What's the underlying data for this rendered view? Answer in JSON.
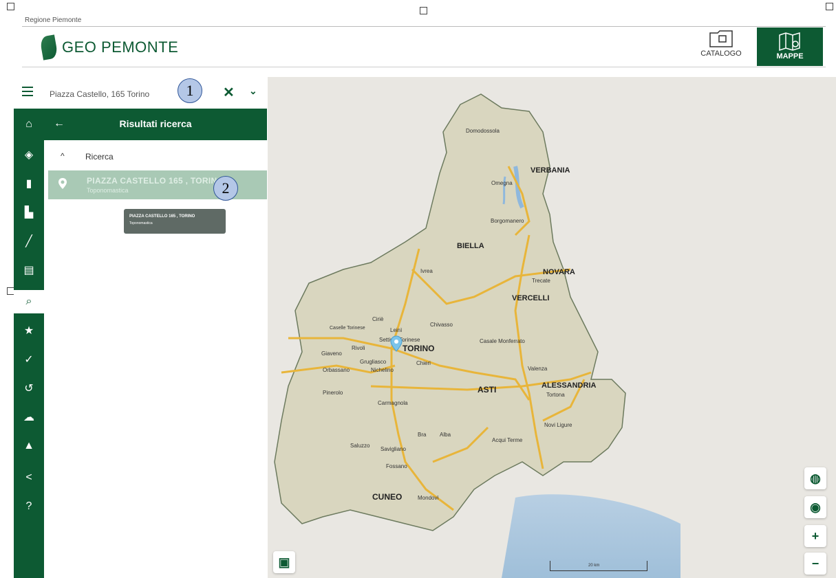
{
  "header": {
    "region_label": "Regione Piemonte",
    "brand": "GEO PEMONTE",
    "catalogo_label": "CATALOGO",
    "mappe_label": "MAPPE"
  },
  "search": {
    "value": "Piazza Castello, 165 Torino",
    "clear_icon": "close-icon",
    "dropdown_icon": "chevron-down-icon"
  },
  "toolbar": {
    "icons": [
      "home-icon",
      "layers-icon",
      "map-icon",
      "document-icon",
      "ruler-icon",
      "print-icon",
      "search-icon",
      "star-icon",
      "satellite-icon",
      "history-icon",
      "cloud-icon",
      "wms-icon",
      "share-icon",
      "help-icon"
    ]
  },
  "panel": {
    "title": "Risultati ricerca",
    "group_label": "Ricerca",
    "result_title": "PIAZZA CASTELLO 165 , TORINO",
    "result_subtitle": "Toponomastica",
    "tooltip_title": "PIAZZA CASTELLO 165 , TORINO",
    "tooltip_subtitle": "Toponomastica"
  },
  "callouts": {
    "one": "1",
    "two": "2"
  },
  "map": {
    "cities": {
      "domodossola": "Domodossola",
      "verbania": "VERBANIA",
      "omegna": "Omegna",
      "borgomanero": "Borgomanero",
      "biella": "BIELLA",
      "ivrea": "Ivrea",
      "novara": "NOVARA",
      "trecate": "Trecate",
      "vercelli": "VERCELLI",
      "cirie": "Ciriè",
      "caselle": "Caselle Torinese",
      "leini": "Leinì",
      "chivasso": "Chivasso",
      "settimo": "Settimo Torinese",
      "giaveno": "Giaveno",
      "rivoli": "Rivoli",
      "torino": "TORINO",
      "grugliasco": "Grugliasco",
      "chieri": "Chieri",
      "orbassano": "Orbassano",
      "nichelino": "Nichelino",
      "casale": "Casale Monferrato",
      "valenza": "Valenza",
      "alessandria": "ALESSANDRIA",
      "tortona": "Tortona",
      "pinerolo": "Pinerolo",
      "asti": "ASTI",
      "carmagnola": "Carmagnola",
      "novi": "Novi Ligure",
      "bra": "Bra",
      "alba": "Alba",
      "acqui": "Acqui Terme",
      "saluzzo": "Saluzzo",
      "savigliano": "Savigliano",
      "fossano": "Fossano",
      "cuneo": "CUNEO",
      "mondovi": "Mondovì"
    },
    "scale_text": "20 km",
    "controls": [
      "globe-icon",
      "locate-icon",
      "zoom-in-icon",
      "zoom-out-icon",
      "basemap-icon"
    ],
    "zoom_in": "+",
    "zoom_out": "−"
  },
  "colors": {
    "brand_green": "#0d5a33",
    "region_fill": "#d9d6bf",
    "road": "#e8b53a",
    "water": "#8fb8dd"
  }
}
